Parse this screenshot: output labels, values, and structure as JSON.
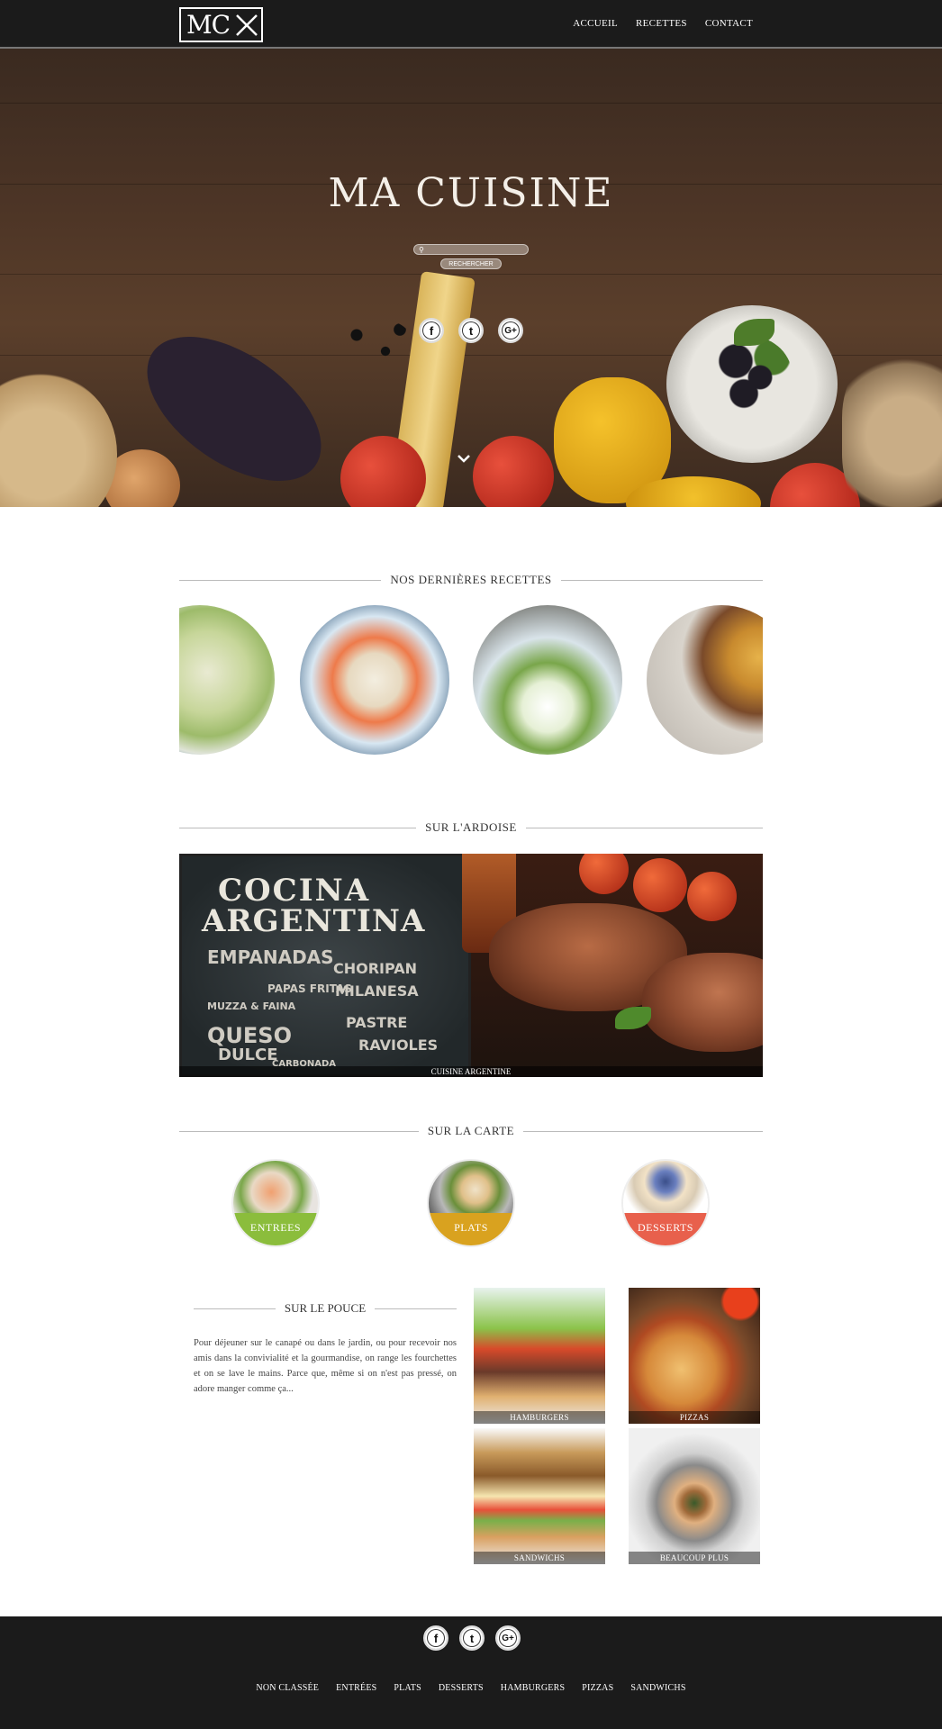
{
  "nav": {
    "logo_text": "MC",
    "links": [
      "ACCUEIL",
      "RECETTES",
      "CONTACT"
    ]
  },
  "hero": {
    "title": "MA CUISINE",
    "search_placeholder": "",
    "search_button": "RECHERCHER",
    "social": [
      "f",
      "t",
      "G+"
    ]
  },
  "sections": {
    "recettes": "NOS DERNIÈRES RECETTES",
    "ardoise": "SUR L'ARDOISE",
    "carte": "SUR LA CARTE",
    "pouce": "SUR LE POUCE"
  },
  "ardoise": {
    "caption": "CUISINE ARGENTINE",
    "board_title_1": "COCINA",
    "board_title_2": "ARGENTINA",
    "board_words": [
      "EMPANADAS",
      "CHORIPAN",
      "PAPAS FRITAS",
      "MILANESA",
      "QUESO",
      "DULCE",
      "PASTRE",
      "RAVIOLES",
      "MUZZA & FAINA",
      "CARBONADA"
    ]
  },
  "carte": [
    {
      "label": "ENTREES",
      "color": "#8bbd3c"
    },
    {
      "label": "PLATS",
      "color": "#d9a21f"
    },
    {
      "label": "DESSERTS",
      "color": "#e8604c"
    }
  ],
  "pouce": {
    "text": "Pour déjeuner sur le canapé ou dans le jardin, ou pour recevoir nos amis dans la convivialité et la gourmandise, on range les fourchettes et on se lave le mains. Parce que, même si on n'est pas pressé, on adore manger comme ça...",
    "tiles": [
      "HAMBURGERS",
      "PIZZAS",
      "SANDWICHS",
      "BEAUCOUP PLUS"
    ]
  },
  "footer": {
    "social": [
      "f",
      "t",
      "G+"
    ],
    "links": [
      "NON CLASSÉE",
      "ENTRÉES",
      "PLATS",
      "DESSERTS",
      "HAMBURGERS",
      "PIZZAS",
      "SANDWICHS"
    ]
  }
}
